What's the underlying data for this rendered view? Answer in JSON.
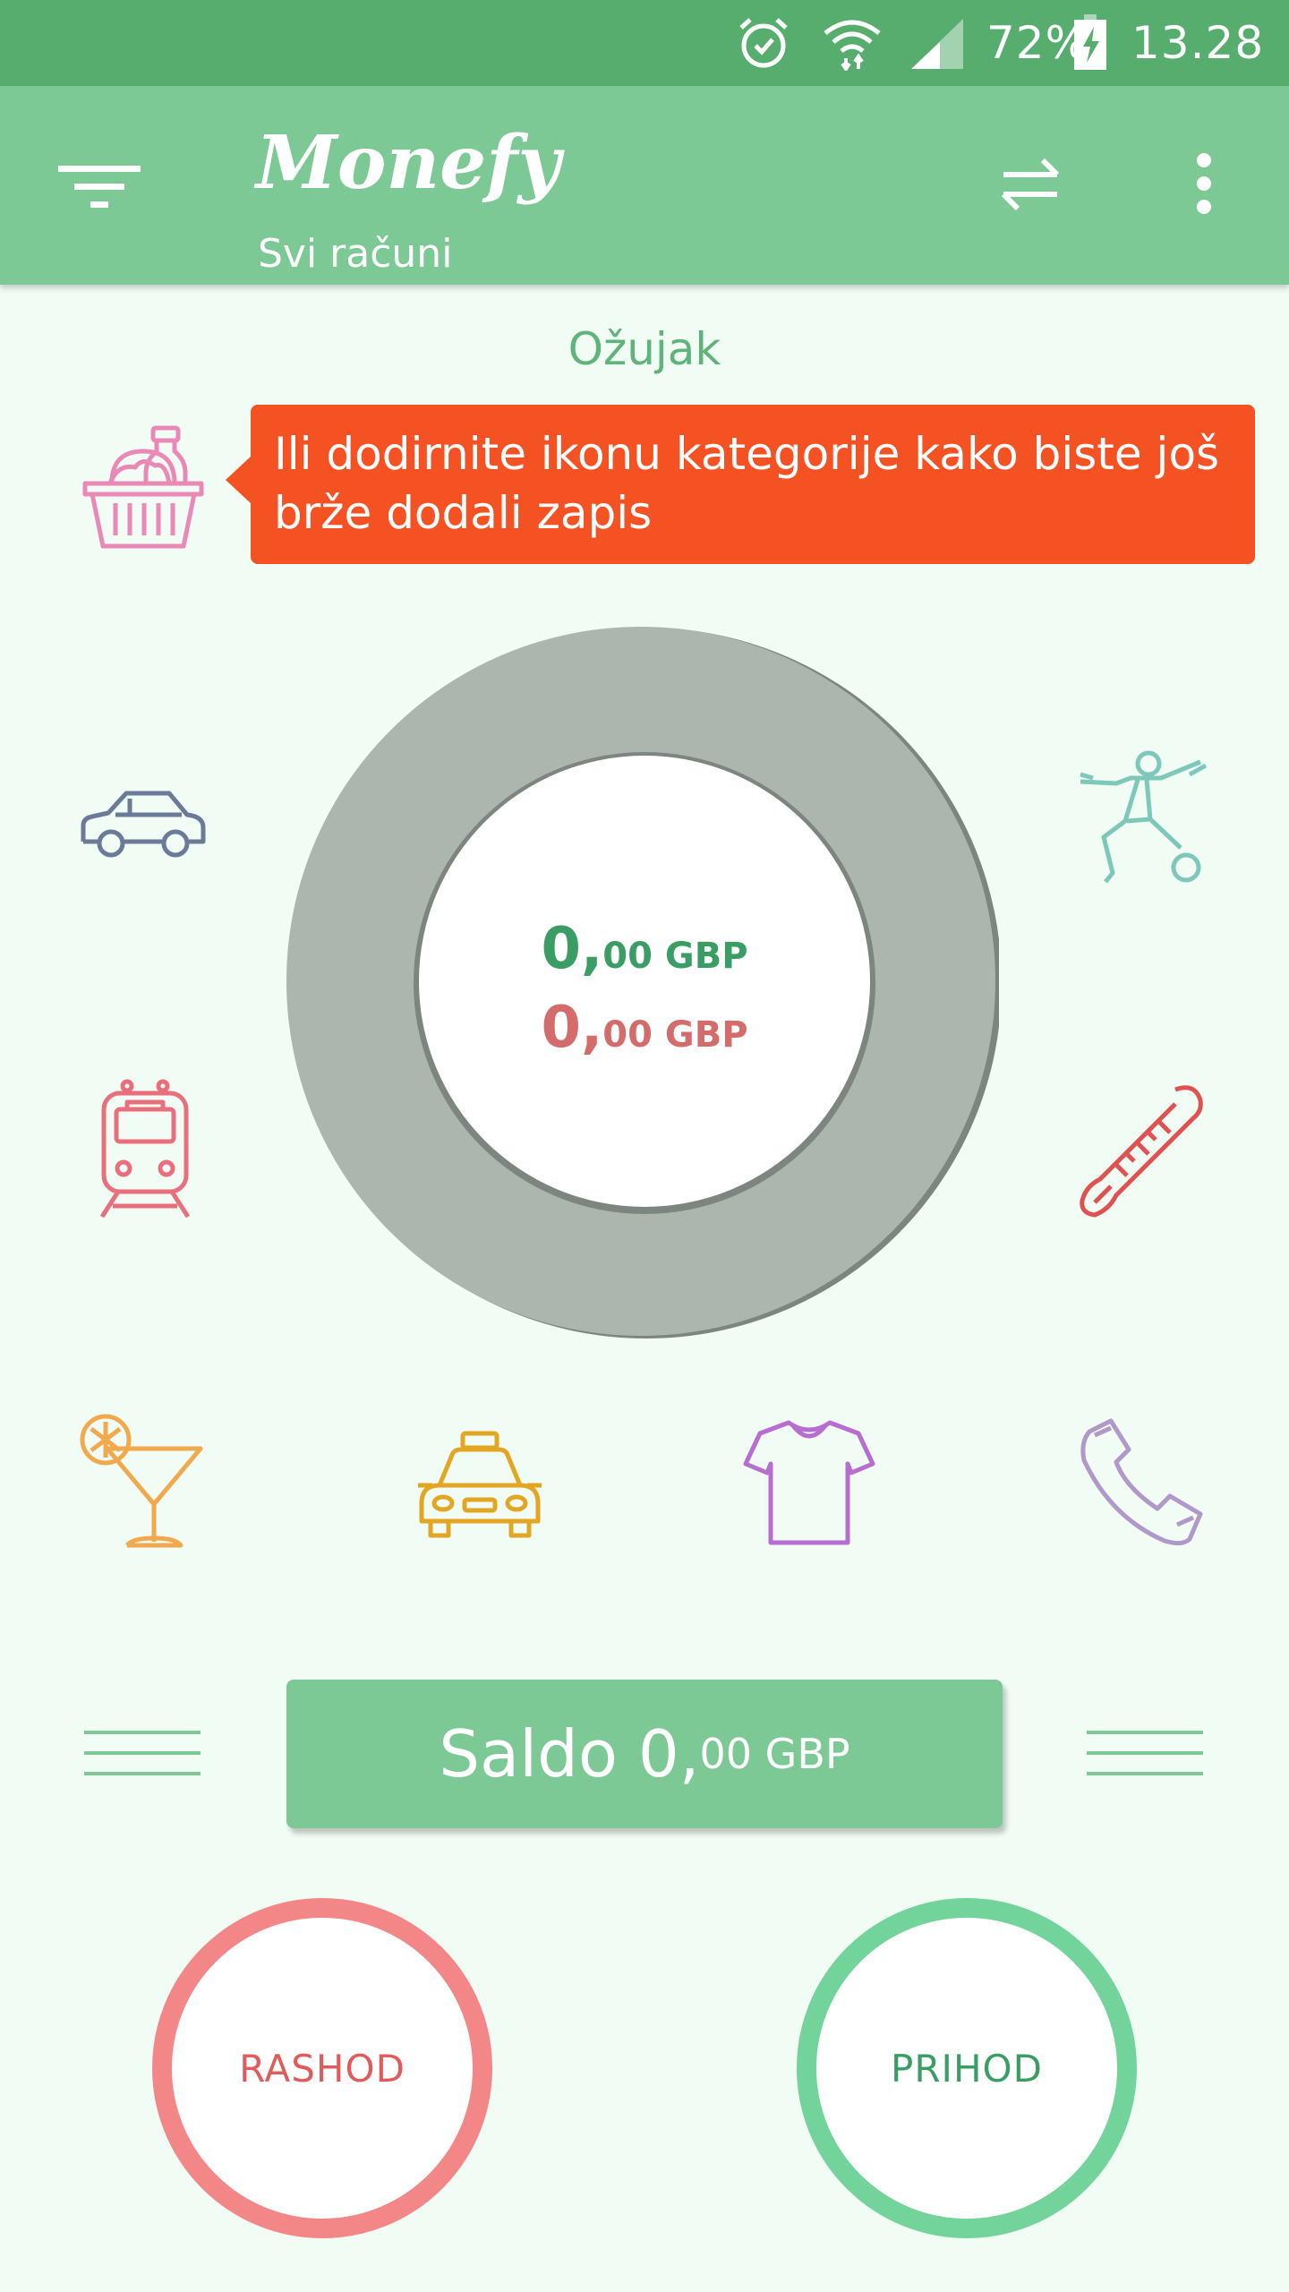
{
  "status_bar": {
    "battery_percent": "72%",
    "time": "13.28",
    "icons": [
      "alarm-icon",
      "wifi-icon",
      "signal-icon",
      "battery-charging-icon"
    ]
  },
  "app_bar": {
    "title": "Monefy",
    "subtitle": "Svi računi",
    "icons": [
      "filter-menu-icon",
      "transfer-icon",
      "more-vert-icon"
    ]
  },
  "main": {
    "month": "Ožujak",
    "tooltip": "Ili dodirnite ikonu kategorije kako biste još brže dodali zapis",
    "income_amount": {
      "whole": "0,",
      "decimals": "00 GBP"
    },
    "expense_amount": {
      "whole": "0,",
      "decimals": "00 GBP"
    },
    "categories": [
      "groceries-icon",
      "car-icon",
      "transport-train-icon",
      "drinks-cocktail-icon",
      "taxi-icon",
      "clothes-tshirt-icon",
      "phone-icon",
      "health-thermometer-icon",
      "sports-icon"
    ]
  },
  "balance": {
    "label": "Saldo",
    "whole": "0,",
    "decimals": "00 GBP"
  },
  "buttons": {
    "expense": "RASHOD",
    "income": "PRIHOD"
  },
  "colors": {
    "status_bar": "#56ad6e",
    "app_bar": "#7cc995",
    "background": "#f0fcf4",
    "tooltip": "#f55223",
    "income": "#3a9d63",
    "expense": "#d46c6c",
    "expense_ring": "#f38686",
    "income_ring": "#72d49a",
    "donut": "#adb5af"
  }
}
